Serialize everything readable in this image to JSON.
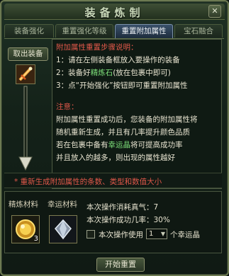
{
  "window": {
    "title": "装备炼制",
    "close_label": "✕"
  },
  "tabs": [
    {
      "label": "装备强化"
    },
    {
      "label": "重置强化等级"
    },
    {
      "label": "重置附加属性"
    },
    {
      "label": "宝石融合"
    }
  ],
  "left": {
    "remove_equip_label": "取出装备"
  },
  "instructions": {
    "heading": "附加属性重置步骤说明：",
    "step1": "1：请在左侧装备框放入要操作的装备",
    "step2_pre": "2：装备好",
    "step2_highlight": "精炼石",
    "step2_post": "(放在包裹中即可)",
    "step3": "3：点“开始强化”按钮即可重置附加属性",
    "note_label": "注意：",
    "note1": "附加属性重置成功后，您装备的附加属性将",
    "note2": "随机重新生成，并且有几率提升颜色品质",
    "note3_pre": "若在包裹中备有",
    "note3_highlight": "幸运晶",
    "note3_post": "将可提高成功率",
    "note4": "并且放入的越多，则出现的属性越好"
  },
  "warning": "* 重新生成附加属性的条数、类型和数值大小",
  "materials": {
    "refine_label": "精炼材料",
    "lucky_label": "幸运材料",
    "refine_count": "3",
    "cost_label": "本次操作消耗真气：7",
    "rate_label": "本次操作成功几率：30%",
    "use_label": "本次操作使用",
    "use_count": "1",
    "use_suffix": "个幸运晶"
  },
  "start_button": "开始重置"
}
